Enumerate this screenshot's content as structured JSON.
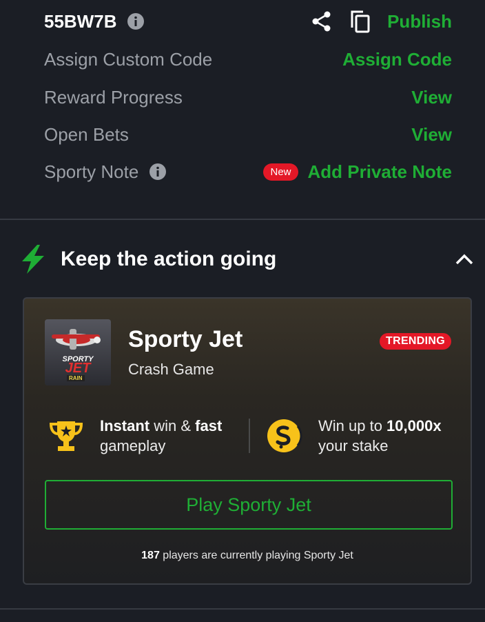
{
  "booking": {
    "code": "55BW7B",
    "publish_label": "Publish"
  },
  "rows": [
    {
      "label": "Assign Custom Code",
      "action": "Assign Code"
    },
    {
      "label": "Reward Progress",
      "action": "View"
    },
    {
      "label": "Open Bets",
      "action": "View"
    },
    {
      "label": "Sporty Note",
      "badge": "New",
      "action": "Add Private Note"
    }
  ],
  "section": {
    "title": "Keep the action going"
  },
  "game": {
    "title": "Sporty Jet",
    "subtitle": "Crash Game",
    "badge": "TRENDING",
    "thumb_text_1": "SPORTY",
    "thumb_text_2": "JET",
    "thumb_text_3": "RAIN",
    "feature1_bold1": "Instant",
    "feature1_mid": " win & ",
    "feature1_bold2": "fast",
    "feature1_line2": "gameplay",
    "feature2_pre": "Win up to ",
    "feature2_bold": "10,000x",
    "feature2_line2": "your stake",
    "play_label": "Play Sporty Jet",
    "players_count": "187",
    "players_text": " players are currently playing Sporty Jet"
  },
  "colors": {
    "accent_green": "#1fae35",
    "badge_red": "#e41827",
    "background": "#1b1e25"
  },
  "icons": {
    "info": "info-icon",
    "share": "share-icon",
    "copy": "copy-icon",
    "bolt": "lightning-bolt-icon",
    "chevron": "chevron-up-icon",
    "trophy": "trophy-icon",
    "coin": "coin-icon"
  }
}
